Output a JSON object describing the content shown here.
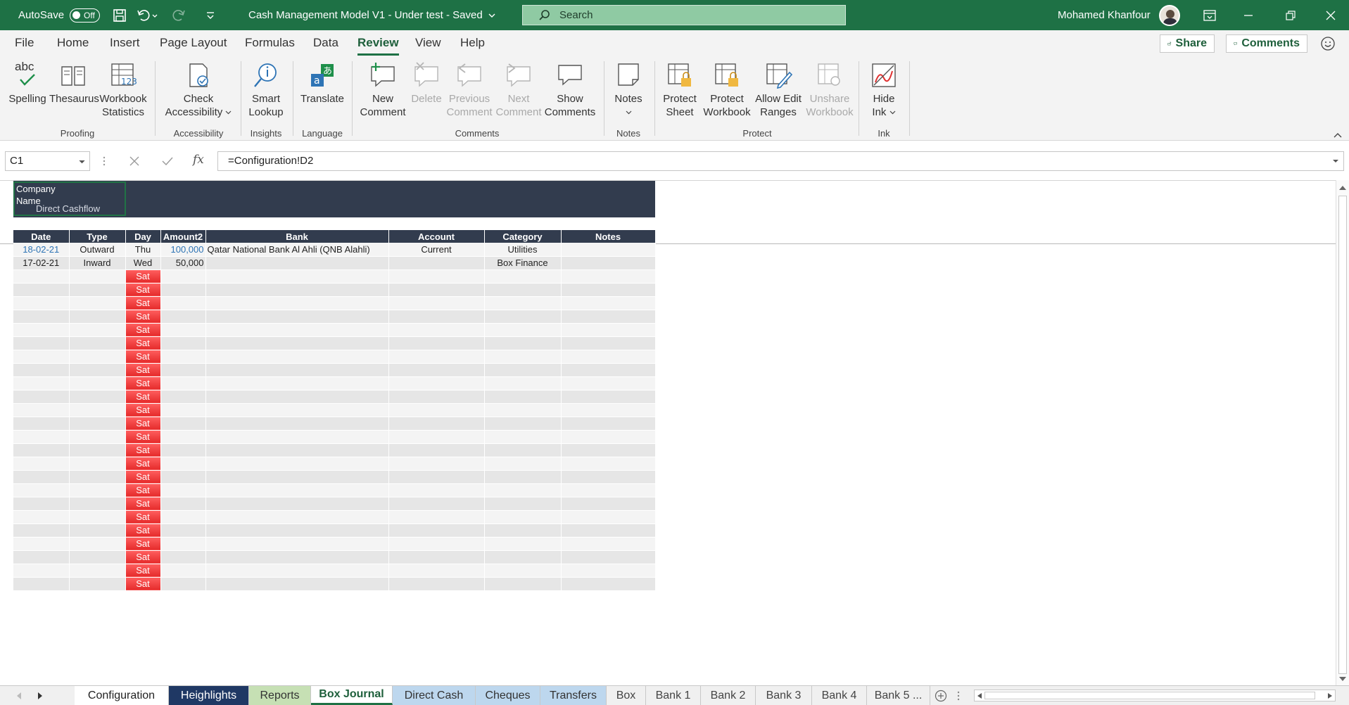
{
  "titlebar": {
    "autosave_label": "AutoSave",
    "autosave_state": "Off",
    "title": "Cash Management Model V1 - Under test",
    "save_status": "Saved",
    "search_placeholder": "Search",
    "user_name": "Mohamed Khanfour"
  },
  "ribbon_tabs": [
    "File",
    "Home",
    "Insert",
    "Page Layout",
    "Formulas",
    "Data",
    "Review",
    "View",
    "Help"
  ],
  "active_tab": "Review",
  "share_label": "Share",
  "comments_label": "Comments",
  "ribbon": {
    "proofing": {
      "label": "Proofing",
      "spelling": "Spelling",
      "thesaurus": "Thesaurus",
      "wb_stats_1": "Workbook",
      "wb_stats_2": "Statistics",
      "abc": "abc"
    },
    "accessibility": {
      "label": "Accessibility",
      "check_1": "Check",
      "check_2": "Accessibility"
    },
    "insights": {
      "label": "Insights",
      "smart_1": "Smart",
      "smart_2": "Lookup"
    },
    "language": {
      "label": "Language",
      "translate": "Translate"
    },
    "comments": {
      "label": "Comments",
      "new_1": "New",
      "new_2": "Comment",
      "delete": "Delete",
      "prev_1": "Previous",
      "prev_2": "Comment",
      "next_1": "Next",
      "next_2": "Comment",
      "show_1": "Show",
      "show_2": "Comments"
    },
    "notes": {
      "label": "Notes",
      "notes": "Notes"
    },
    "protect": {
      "label": "Protect",
      "ps_1": "Protect",
      "ps_2": "Sheet",
      "pw_1": "Protect",
      "pw_2": "Workbook",
      "ae_1": "Allow Edit",
      "ae_2": "Ranges",
      "uw_1": "Unshare",
      "uw_2": "Workbook"
    },
    "ink": {
      "label": "Ink",
      "hide_1": "Hide",
      "hide_2": "Ink"
    }
  },
  "formula_bar": {
    "name_box": "C1",
    "fx": "fx",
    "formula": "=Configuration!D2"
  },
  "sheet": {
    "banner_line1": "Company",
    "banner_line2": "Name",
    "banner_sub": "Direct Cashflow",
    "headers": [
      "Date",
      "Type",
      "Day",
      "Amount2",
      "Bank",
      "Account",
      "Category",
      "Notes"
    ],
    "rows": [
      {
        "date": "18-02-21",
        "type": "Outward",
        "day": "Thu",
        "amount": "100,000",
        "bank": "Qatar National Bank Al Ahli (QNB Alahli)",
        "account": "Current",
        "category": "Utilities",
        "notes": ""
      },
      {
        "date": "17-02-21",
        "type": "Inward",
        "day": "Wed",
        "amount": "50,000",
        "bank": "",
        "account": "",
        "category": "Box Finance",
        "notes": ""
      }
    ],
    "empty_day_label": "Sat"
  },
  "sheet_tabs": [
    "Configuration",
    "Heighlights",
    "Reports",
    "Box Journal",
    "Direct Cash",
    "Cheques",
    "Transfers",
    "Box",
    "Bank 1",
    "Bank 2",
    "Bank 3",
    "Bank 4",
    "Bank 5 ..."
  ],
  "active_sheet": "Box Journal"
}
